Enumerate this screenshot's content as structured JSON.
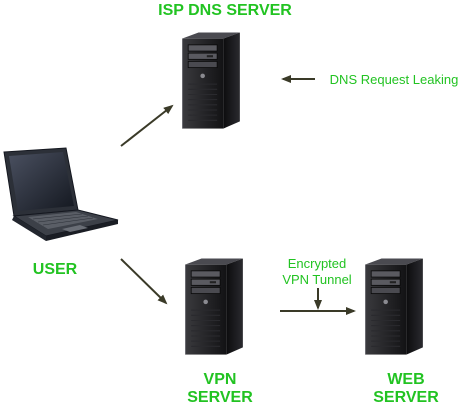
{
  "nodes": {
    "isp_dns_server": {
      "label": "ISP DNS SERVER",
      "icon": "server-tower-icon"
    },
    "user": {
      "label": "USER",
      "icon": "laptop-icon"
    },
    "vpn_server": {
      "label_line1": "VPN",
      "label_line2": "SERVER",
      "icon": "server-tower-icon"
    },
    "web_server": {
      "label_line1": "WEB",
      "label_line2": "SERVER",
      "icon": "server-tower-icon"
    }
  },
  "annotations": {
    "dns_leak": "DNS Request Leaking",
    "tunnel_line1": "Encrypted",
    "tunnel_line2": "VPN Tunnel"
  },
  "edges": [
    {
      "from": "user",
      "to": "isp_dns_server"
    },
    {
      "from": "user",
      "to": "vpn_server"
    },
    {
      "from": "vpn_server",
      "to": "web_server"
    }
  ],
  "colors": {
    "label_green": "#22c322",
    "arrow": "#3a3a28",
    "server_body": "#1e1e22",
    "laptop_body": "#2a2e36"
  }
}
